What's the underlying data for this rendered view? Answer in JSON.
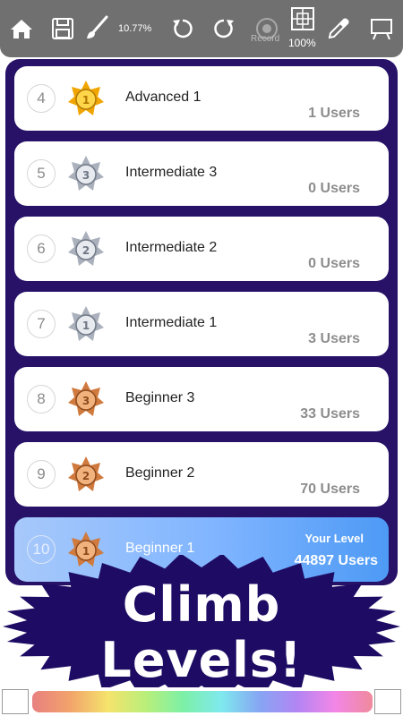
{
  "toolbar": {
    "zoom_percent": "10.77%",
    "record_label": "Record",
    "scale_percent": "100%",
    "icons": [
      "home-icon",
      "save-icon",
      "brush-icon",
      "undo-icon",
      "redo-icon",
      "record-icon",
      "grid-icon",
      "eyedropper-icon",
      "easel-icon"
    ]
  },
  "levels": [
    {
      "number": "4",
      "name": "Advanced 1",
      "users": "1 Users",
      "medal": "gold",
      "rank": "1"
    },
    {
      "number": "5",
      "name": "Intermediate 3",
      "users": "0 Users",
      "medal": "silver",
      "rank": "3"
    },
    {
      "number": "6",
      "name": "Intermediate 2",
      "users": "0 Users",
      "medal": "silver",
      "rank": "2"
    },
    {
      "number": "7",
      "name": "Intermediate 1",
      "users": "3 Users",
      "medal": "silver",
      "rank": "1"
    },
    {
      "number": "8",
      "name": "Beginner 3",
      "users": "33 Users",
      "medal": "bronze",
      "rank": "3"
    },
    {
      "number": "9",
      "name": "Beginner 2",
      "users": "70 Users",
      "medal": "bronze",
      "rank": "2"
    },
    {
      "number": "10",
      "name": "Beginner 1",
      "users": "44897 Users",
      "medal": "bronze",
      "rank": "1",
      "your_level_label": "Your Level"
    }
  ],
  "banner": {
    "line1": "Climb",
    "line2": "Levels!"
  },
  "colors": {
    "toolbar": "#707070",
    "panel": "#271268",
    "banner": "#1e0b63",
    "active_row_start": "#a7c9fb",
    "active_row_end": "#4d9af5",
    "gold": "#f4b21b",
    "silver": "#a9b0bb",
    "bronze": "#d07a3e",
    "swatch_right": "#f08275"
  }
}
